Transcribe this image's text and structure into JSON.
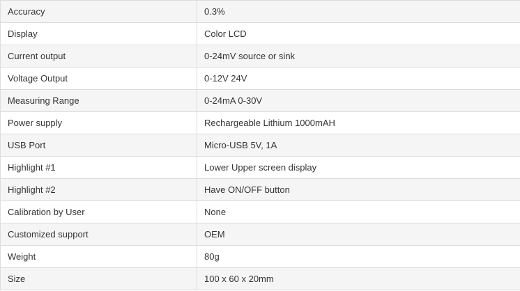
{
  "spec_table": {
    "rows": [
      {
        "label": "Accuracy",
        "value": "0.3%"
      },
      {
        "label": "Display",
        "value": "Color LCD"
      },
      {
        "label": "Current output",
        "value": "0-24mV source or sink"
      },
      {
        "label": "Voltage Output",
        "value": "0-12V 24V"
      },
      {
        "label": "Measuring Range",
        "value": "0-24mA 0-30V"
      },
      {
        "label": "Power supply",
        "value": "Rechargeable Lithium 1000mAH"
      },
      {
        "label": "USB Port",
        "value": "Micro-USB 5V, 1A"
      },
      {
        "label": "Highlight #1",
        "value": "Lower Upper screen display"
      },
      {
        "label": "Highlight #2",
        "value": "Have ON/OFF button"
      },
      {
        "label": "Calibration by User",
        "value": "None"
      },
      {
        "label": "Customized support",
        "value": "OEM"
      },
      {
        "label": "Weight",
        "value": "80g"
      },
      {
        "label": "Size",
        "value": "100 x 60 x 20mm"
      }
    ]
  }
}
